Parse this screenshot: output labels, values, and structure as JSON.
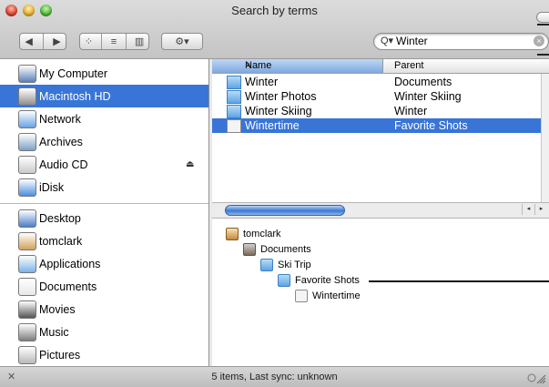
{
  "window": {
    "title": "Search by terms"
  },
  "toolbar": {
    "back_glyph": "◀",
    "forward_glyph": "▶",
    "view_icon_glyph": "⁘",
    "view_list_glyph": "≡",
    "view_column_glyph": "▥",
    "action_glyph": "⚙▾",
    "search_icon_glyph": "Q▾",
    "search_value": "Winter",
    "search_clear_glyph": "×"
  },
  "sidebar": {
    "items": [
      {
        "label": "My Computer",
        "icon": "computer-icon",
        "color": "#5b7fb8"
      },
      {
        "label": "Macintosh HD",
        "icon": "hard-disk-icon",
        "color": "#8f8f8f"
      },
      {
        "label": "Network",
        "icon": "network-globe-icon",
        "color": "#6aa3e0"
      },
      {
        "label": "Archives",
        "icon": "archives-globe-icon",
        "color": "#7aa0c8"
      },
      {
        "label": "Audio CD",
        "icon": "audio-cd-icon",
        "color": "#c9c9c9",
        "eject": "⏏"
      },
      {
        "label": "iDisk",
        "icon": "idisk-icon",
        "color": "#4c8fe0"
      },
      {
        "label": "Desktop",
        "icon": "desktop-icon",
        "color": "#4a7fc7"
      },
      {
        "label": "tomclark",
        "icon": "home-icon",
        "color": "#d2a25a"
      },
      {
        "label": "Applications",
        "icon": "applications-icon",
        "color": "#7ab2e8"
      },
      {
        "label": "Documents",
        "icon": "documents-icon",
        "color": "#e8e8e8"
      },
      {
        "label": "Movies",
        "icon": "movies-icon",
        "color": "#555555"
      },
      {
        "label": "Music",
        "icon": "music-icon",
        "color": "#7d7d7d"
      },
      {
        "label": "Pictures",
        "icon": "pictures-icon",
        "color": "#b9b9b9"
      }
    ],
    "selected_index": 1
  },
  "list": {
    "columns": {
      "name": "Name",
      "parent": "Parent",
      "sort_glyph": "▲"
    },
    "rows": [
      {
        "name": "Winter",
        "parent": "Documents",
        "icon": "folder-icon"
      },
      {
        "name": "Winter Photos",
        "parent": "Winter Skiing",
        "icon": "folder-icon"
      },
      {
        "name": "Winter Skiing",
        "parent": "Winter",
        "icon": "folder-icon"
      },
      {
        "name": "Wintertime",
        "parent": "Favorite Shots",
        "icon": "document-icon"
      }
    ],
    "selected_index": 3,
    "scroll_left_glyph": "◂",
    "scroll_right_glyph": "▸"
  },
  "path": {
    "items": [
      {
        "label": "tomclark",
        "icon": "home-icon"
      },
      {
        "label": "Documents",
        "icon": "documents-folder-icon"
      },
      {
        "label": "Ski Trip",
        "icon": "folder-icon"
      },
      {
        "label": "Favorite Shots",
        "icon": "folder-icon"
      },
      {
        "label": "Wintertime",
        "icon": "document-icon"
      }
    ]
  },
  "status": {
    "text": "5 items, Last sync: unknown",
    "tool_glyph": "✕"
  },
  "colors": {
    "selection": "#3875d7",
    "folder": "#5ea4e4"
  }
}
